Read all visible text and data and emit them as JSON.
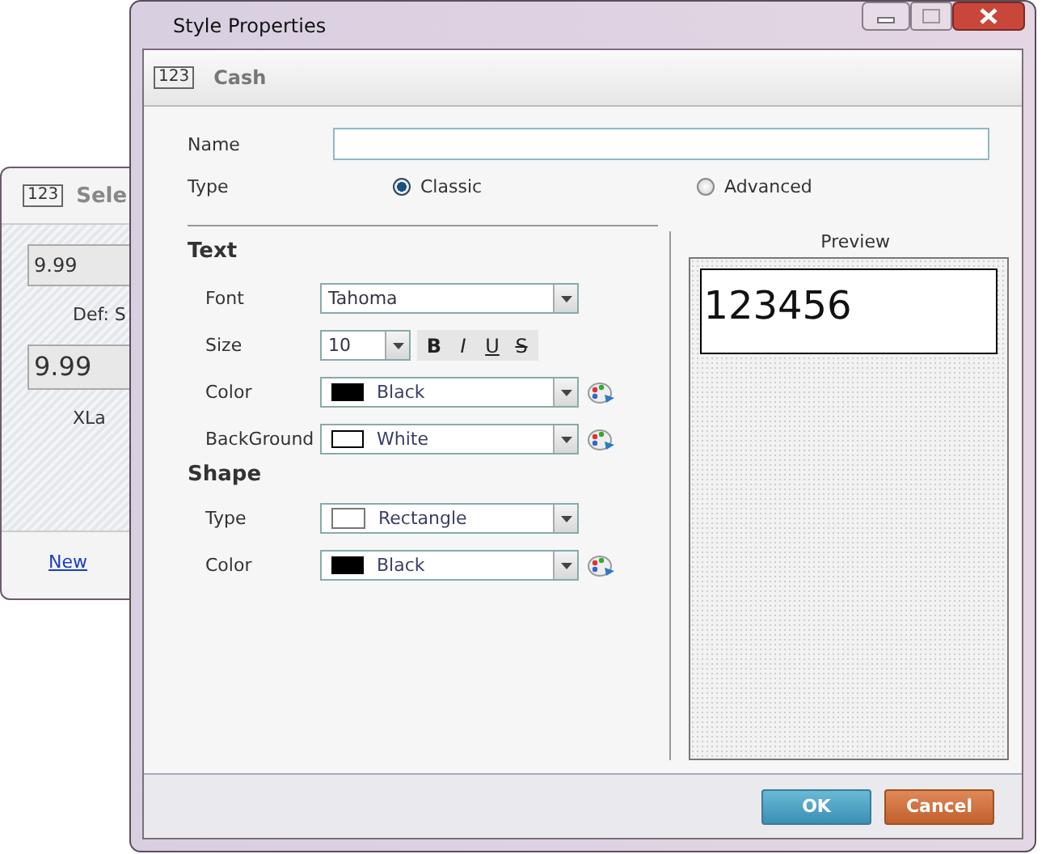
{
  "background_window": {
    "badge": "123",
    "title": "Sele",
    "values": [
      "9.99",
      "9.99"
    ],
    "labels": [
      "Def: S",
      "XLa"
    ],
    "link": "New"
  },
  "dialog": {
    "title": "Style Properties",
    "header": {
      "badge": "123",
      "title": "Cash"
    },
    "name": {
      "label": "Name"
    },
    "type": {
      "label": "Type",
      "options": [
        {
          "label": "Classic",
          "selected": true
        },
        {
          "label": "Advanced",
          "selected": false
        }
      ]
    },
    "text_section": {
      "title": "Text",
      "font": {
        "label": "Font",
        "value": "Tahoma"
      },
      "size": {
        "label": "Size",
        "value": "10"
      },
      "styles": [
        "B",
        "I",
        "U",
        "S"
      ],
      "color": {
        "label": "Color",
        "value": "Black",
        "color": "#000000"
      },
      "background": {
        "label": "BackGround",
        "value": "White",
        "color": "#ffffff"
      }
    },
    "shape_section": {
      "title": "Shape",
      "type": {
        "label": "Type",
        "value": "Rectangle",
        "color": "#ffffff"
      },
      "color": {
        "label": "Color",
        "value": "Black",
        "color": "#000000"
      }
    },
    "preview": {
      "label": "Preview",
      "sample": "123456"
    },
    "buttons": [
      {
        "label": "OK",
        "kind": "ok"
      },
      {
        "label": "Cancel",
        "kind": "cancel"
      }
    ]
  }
}
